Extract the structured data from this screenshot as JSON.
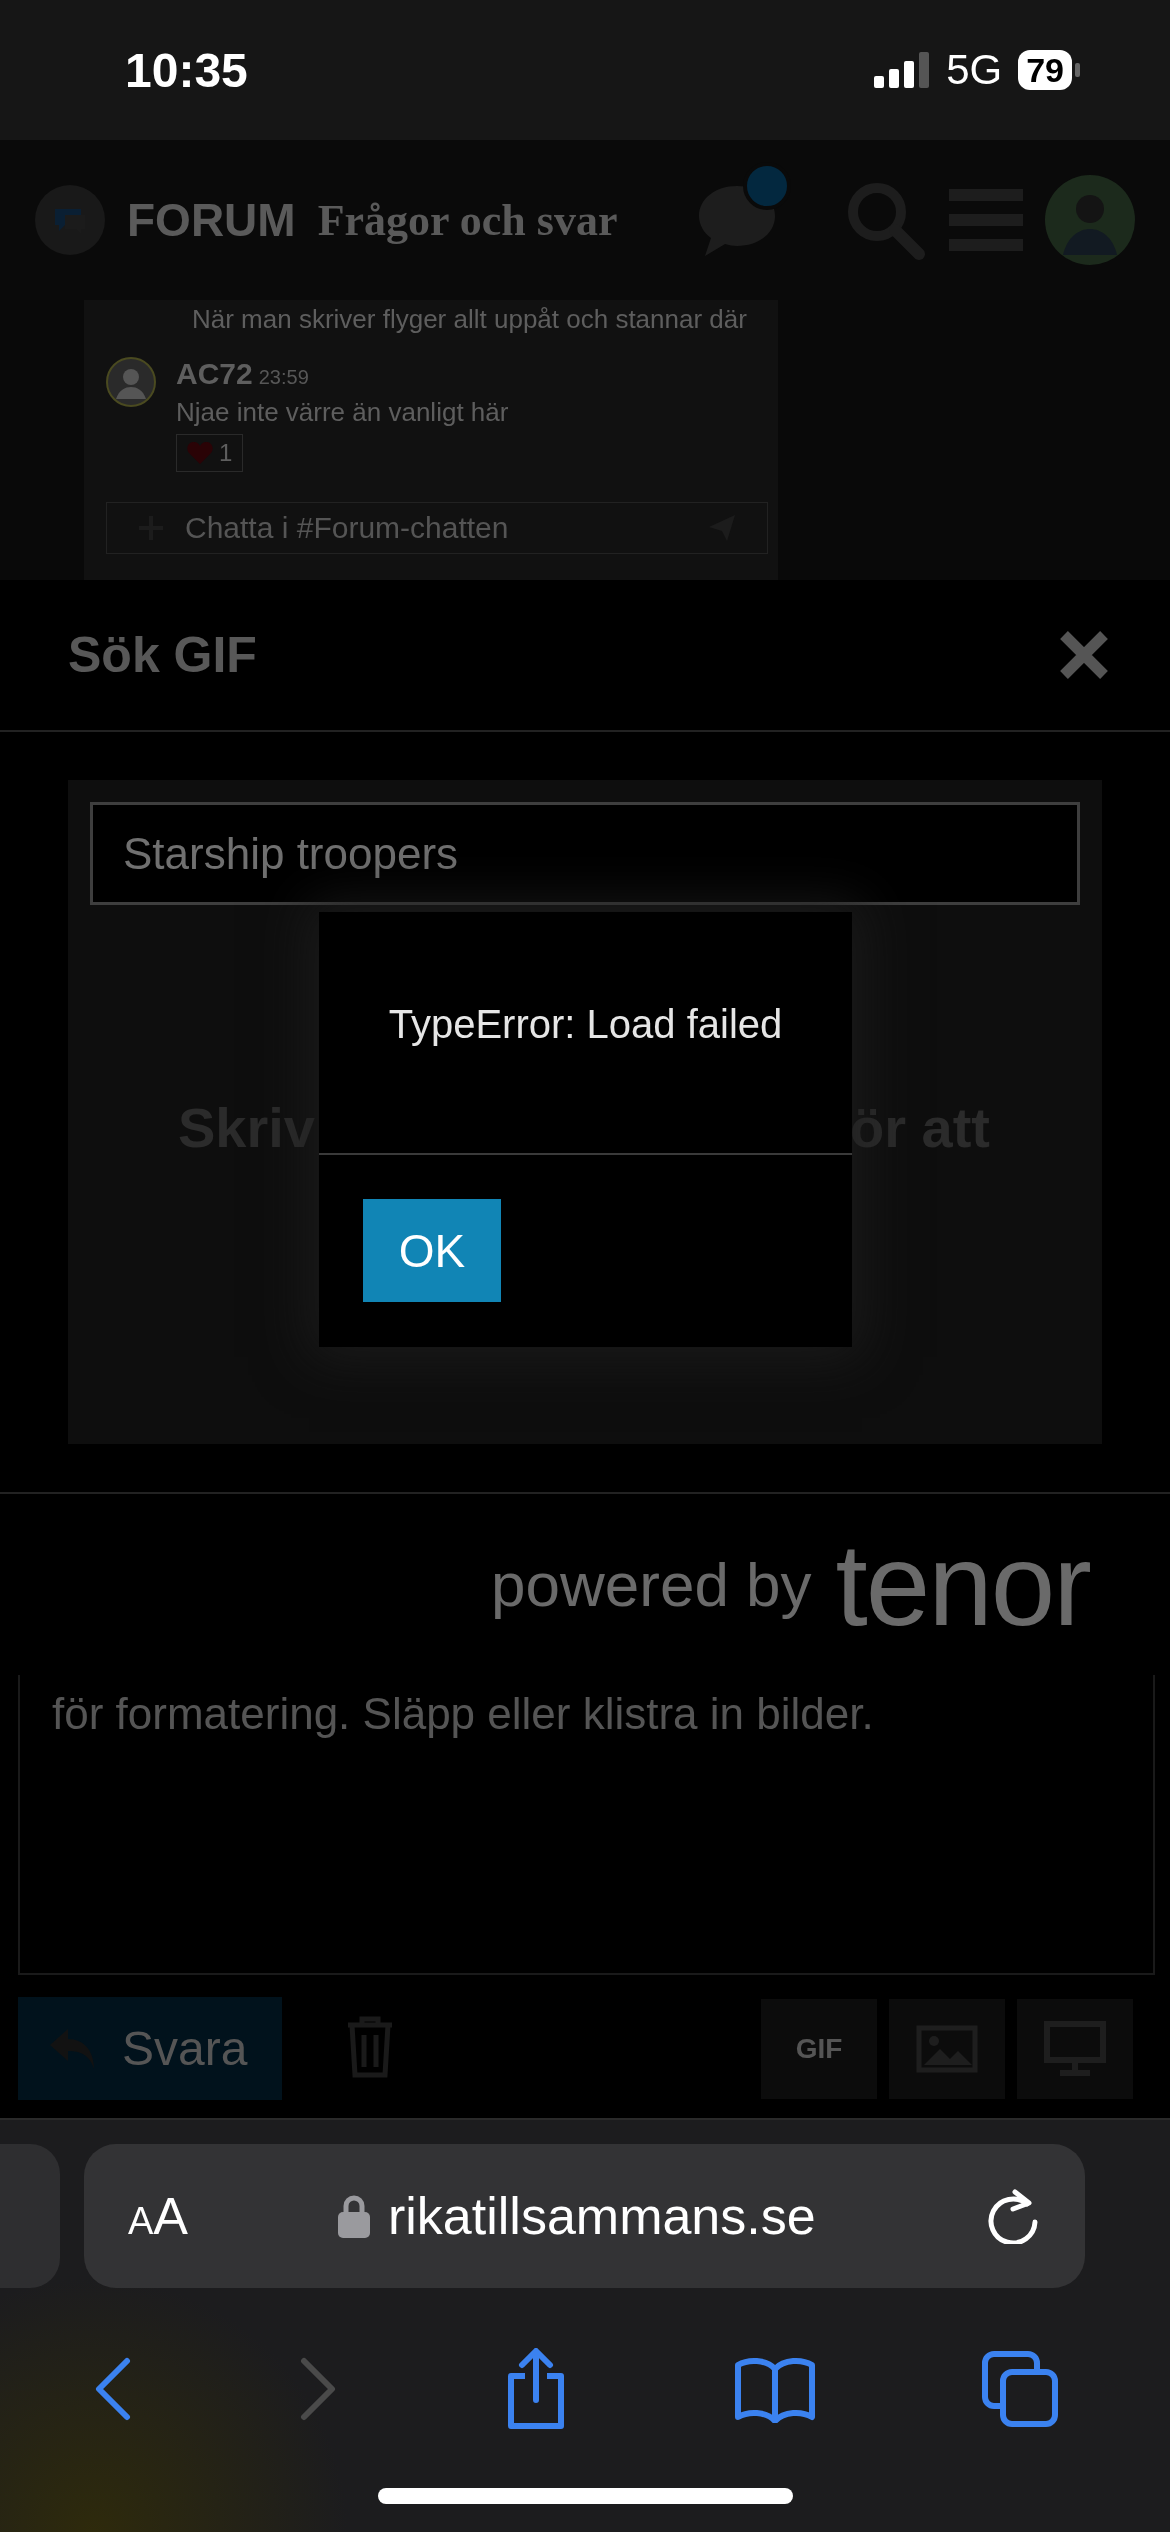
{
  "status_bar": {
    "time": "10:35",
    "network": "5G",
    "battery": "79"
  },
  "forum_header": {
    "brand": "FORUM",
    "section": "Frågor och svar",
    "chat_unread": true
  },
  "chat": {
    "messages": [
      {
        "text": "När man skriver flyger allt uppåt och stannar där"
      },
      {
        "author": "AC72",
        "time": "23:59",
        "text": "Njae inte värre än vanligt här",
        "reactions": [
          {
            "count": "1"
          }
        ]
      }
    ],
    "input": {
      "placeholder": "Chatta i #Forum-chatten"
    }
  },
  "gif_modal": {
    "title": "Sök GIF",
    "search": {
      "value": "Starship troopers"
    },
    "hint_parts": [
      "Skriv",
      "ör att"
    ],
    "attribution": {
      "prefix": "powered by",
      "brand": "tenor"
    }
  },
  "alert": {
    "message": "TypeError: Load failed",
    "buttons": [
      "OK"
    ]
  },
  "editor": {
    "placeholder": "för formatering. Släpp eller klistra in bilder."
  },
  "composer_toolbar": {
    "reply": "Svara",
    "gif": "GIF"
  },
  "browser": {
    "text_size": "AA",
    "url": "rikatillsammans.se",
    "back_enabled": true,
    "forward_enabled": false
  }
}
